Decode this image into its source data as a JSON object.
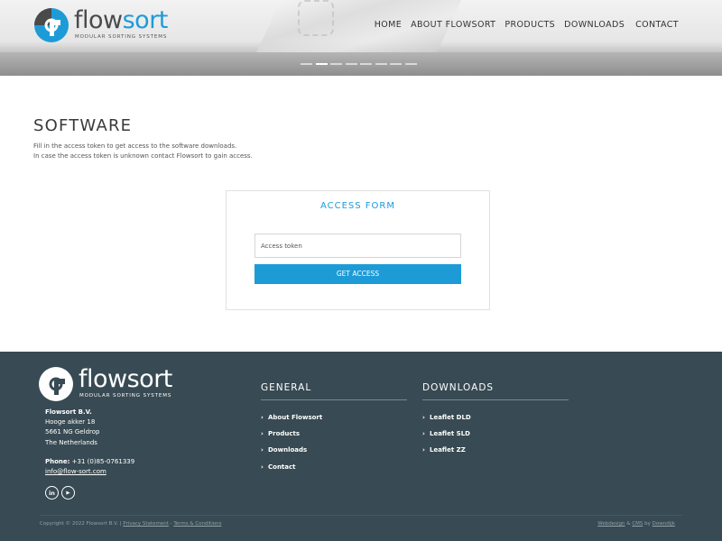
{
  "brand": {
    "word_part1": "flow",
    "word_part2": "sort",
    "tagline": "MODULAR SORTING SYSTEMS",
    "accent_color": "#1d9bd7",
    "footer_bg": "#384a53"
  },
  "nav": {
    "items": [
      {
        "label": "HOME"
      },
      {
        "label": "ABOUT FLOWSORT"
      },
      {
        "label": "PRODUCTS"
      },
      {
        "label": "DOWNLOADS"
      },
      {
        "label": "CONTACT"
      }
    ]
  },
  "slider": {
    "dot_count": 8,
    "active_index": 1
  },
  "main": {
    "title": "SOFTWARE",
    "intro_line1": "Fill in the access token to get access to the software downloads.",
    "intro_line2": "In case the access token is unknown contact Flowsort to gain access."
  },
  "form": {
    "title": "ACCESS FORM",
    "token_placeholder": "Access token",
    "submit_label": "GET ACCESS"
  },
  "footer": {
    "logo_word": "flowsort",
    "logo_tagline": "MODULAR SORTING SYSTEMS",
    "company": "Flowsort B.V.",
    "address_line1": "Hooge akker 18",
    "address_line2": "5661 NG Geldrop",
    "address_line3": "The Netherlands",
    "phone_label": "Phone:",
    "phone": " +31 (0)85-0761339",
    "email": "info@flow-sort.com",
    "social": [
      {
        "icon": "linkedin-icon",
        "glyph": "in"
      },
      {
        "icon": "youtube-icon",
        "glyph": "▶"
      }
    ],
    "general": {
      "heading": "GENERAL",
      "links": [
        "About Flowsort",
        "Products",
        "Downloads",
        "Contact"
      ]
    },
    "downloads": {
      "heading": "DOWNLOADS",
      "links": [
        "Leaflet DLD",
        "Leaflet SLD",
        "Leaflet ZZ"
      ]
    },
    "copyright": "Copyright © 2022 Flowsort B.V. |",
    "privacy_label": "Privacy Statement",
    "separator": "-",
    "terms_label": "Terms & Conditions",
    "credit_webdesign": "Webdesign",
    "credit_amp": "&",
    "credit_cms": "CMS",
    "credit_by": "by",
    "credit_company": "Downdijk"
  }
}
